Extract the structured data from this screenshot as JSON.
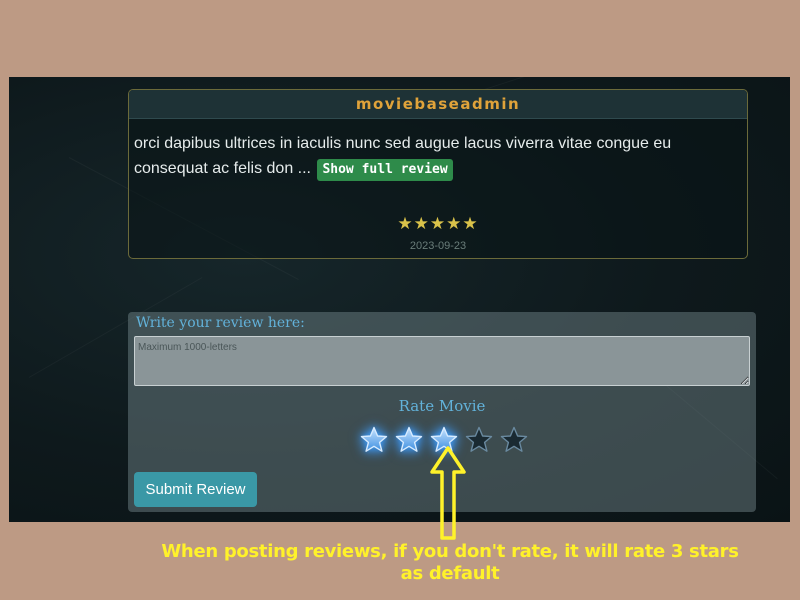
{
  "review": {
    "author": "moviebaseadmin",
    "excerpt": "orci dapibus ultrices in iaculis nunc sed augue lacus viverra vitae congue eu consequat ac felis don ...",
    "show_full_label": "Show full review",
    "stars_text": "★★★★★",
    "rating": 5,
    "date": "2023-09-23"
  },
  "form": {
    "label": "Write your review here:",
    "placeholder": "Maximum 1000-letters",
    "value": "",
    "rate_label": "Rate Movie",
    "rating_selected": 3,
    "rating_max": 5,
    "submit_label": "Submit Review"
  },
  "annotation": {
    "text": "When posting reviews, if you don't rate, it will rate 3 stars as default"
  },
  "colors": {
    "page_background": "#bd9a84",
    "author": "#e0a33a",
    "accent_blue": "#62b2da",
    "button": "#3a98a6",
    "annotation": "#fff22a",
    "star_review": "#d9c24a"
  },
  "icons": {
    "rate_star": "star-icon",
    "annotation_arrow": "arrow-up-icon"
  }
}
